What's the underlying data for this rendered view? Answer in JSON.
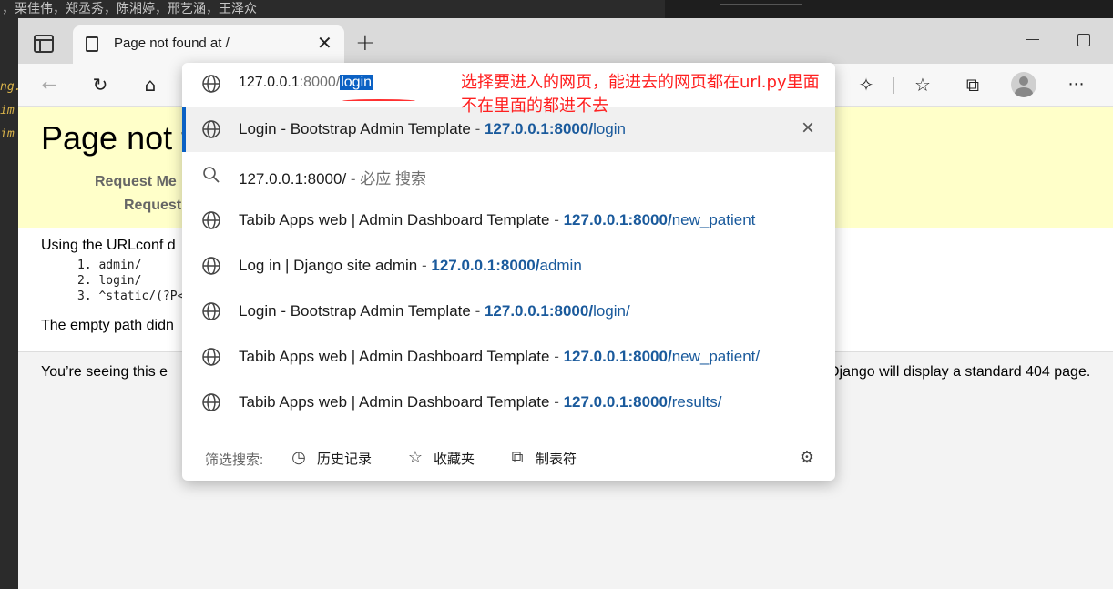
{
  "background": {
    "top_text": "，栗佳伟，郑丞秀，陈湘婷，邢艺涵，王泽众",
    "left_code": [
      "ng.",
      "im",
      "im"
    ]
  },
  "browser": {
    "tab_title": "Page not found at /",
    "tab_close": "✕",
    "new_tab": "+",
    "icons": {
      "back": "←",
      "refresh": "↻",
      "home": "⌂",
      "extensions": "✧",
      "favorites": "☆",
      "collections": "⧉",
      "more": "⋯"
    }
  },
  "page": {
    "title": "Page not f",
    "request_method_label": "Request Me",
    "request_url_label": "Request",
    "urlconf_text": "Using the URLconf d",
    "patterns": [
      "1. admin/",
      "2. login/",
      "3. ^static/(?P<"
    ],
    "empty_path_text": "The empty path didn",
    "explain_left": "You’re seeing this e",
    "explain_right": "Django will display a standard 404 page."
  },
  "omnibox": {
    "host": "127.0.0.1",
    "port_path": ":8000/",
    "selected": "login"
  },
  "suggestions": [
    {
      "title": "Login - Bootstrap Admin Template",
      "host": "127.0.0.1:8000/",
      "path": "login",
      "active": true
    },
    {
      "title": "127.0.0.1:8000/",
      "search": "- 必应 搜索",
      "type": "search"
    },
    {
      "title": "Tabib Apps web | Admin Dashboard Template",
      "host": "127.0.0.1:8000/",
      "path": "new_patient"
    },
    {
      "title": "Log in | Django site admin",
      "host": "127.0.0.1:8000/",
      "path": "admin"
    },
    {
      "title": "Login - Bootstrap Admin Template",
      "host": "127.0.0.1:8000/",
      "path": "login/"
    },
    {
      "title": "Tabib Apps web | Admin Dashboard Template",
      "host": "127.0.0.1:8000/",
      "path": "new_patient/"
    },
    {
      "title": "Tabib Apps web | Admin Dashboard Template",
      "host": "127.0.0.1:8000/",
      "path": "results/"
    }
  ],
  "dropdown_footer": {
    "label": "筛选搜索:",
    "history": "历史记录",
    "favorites": "收藏夹",
    "tabs": "制表符"
  },
  "annotation": {
    "line1": "选择要进入的网页，能进去的网页都在url.py里面",
    "line2": "不在里面的都进不去"
  },
  "colors": {
    "accent": "#0b61c4",
    "link": "#1a5a9c",
    "annotation": "#ff2020",
    "header_bg": "#ffffc9"
  }
}
